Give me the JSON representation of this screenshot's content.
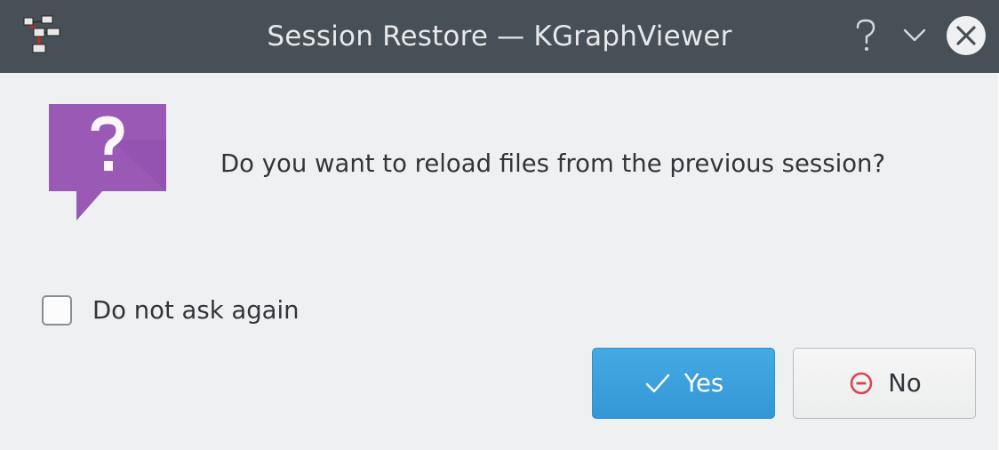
{
  "window": {
    "title": "Session Restore — KGraphViewer",
    "app_icon": "kgraphviewer-app-icon",
    "controls": {
      "help_icon": "help-question-icon",
      "minimize_icon": "chevron-down-icon",
      "close_icon": "close-icon"
    }
  },
  "dialog": {
    "icon": "question-bubble-icon",
    "icon_color": "#9b59b6",
    "message": "Do you want to reload files from the previous session?",
    "dont_ask": {
      "label": "Do not ask again",
      "checked": false
    },
    "buttons": {
      "yes": {
        "label": "Yes",
        "icon": "checkmark-icon"
      },
      "no": {
        "label": "No",
        "icon": "remove-circle-icon",
        "icon_color": "#da4453"
      }
    }
  }
}
